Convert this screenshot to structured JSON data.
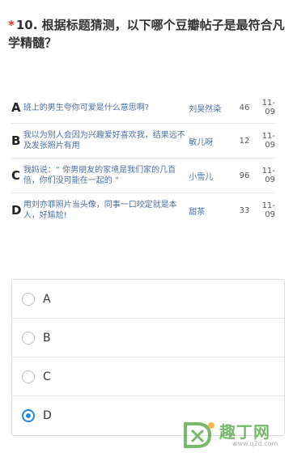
{
  "question": {
    "required_mark": "*",
    "text": "10. 根据标题猜测，以下哪个豆瓣帖子是最符合凡学精髓？"
  },
  "posts": [
    {
      "letter": "A",
      "title": "班上的男生夸你可爱是什么意思啊?",
      "author": "刘昊然染",
      "count": "46",
      "date": "11-09"
    },
    {
      "letter": "B",
      "title": "我以为别人会因为兴趣爱好喜欢我，结果远不及发张照片有用",
      "author": "敏儿呀",
      "count": "12",
      "date": "11-09"
    },
    {
      "letter": "C",
      "title": "我妈说：“ 你男朋友的家境是我们家的几百倍，你们没可能在一起的 ”",
      "author": "小雪儿",
      "count": "96",
      "date": "11-09"
    },
    {
      "letter": "D",
      "title": "用刘亦菲照片当头像，同事一口咬定就是本人，好尴尬!",
      "author": "甜茶",
      "count": "33",
      "date": "11-09"
    }
  ],
  "options": [
    {
      "label": "A",
      "checked": false
    },
    {
      "label": "B",
      "checked": false
    },
    {
      "label": "C",
      "checked": false
    },
    {
      "label": "D",
      "checked": true
    }
  ],
  "watermark": {
    "text": "趣丁网",
    "url": "www.q2d.com",
    "color": "#4aa33a"
  }
}
